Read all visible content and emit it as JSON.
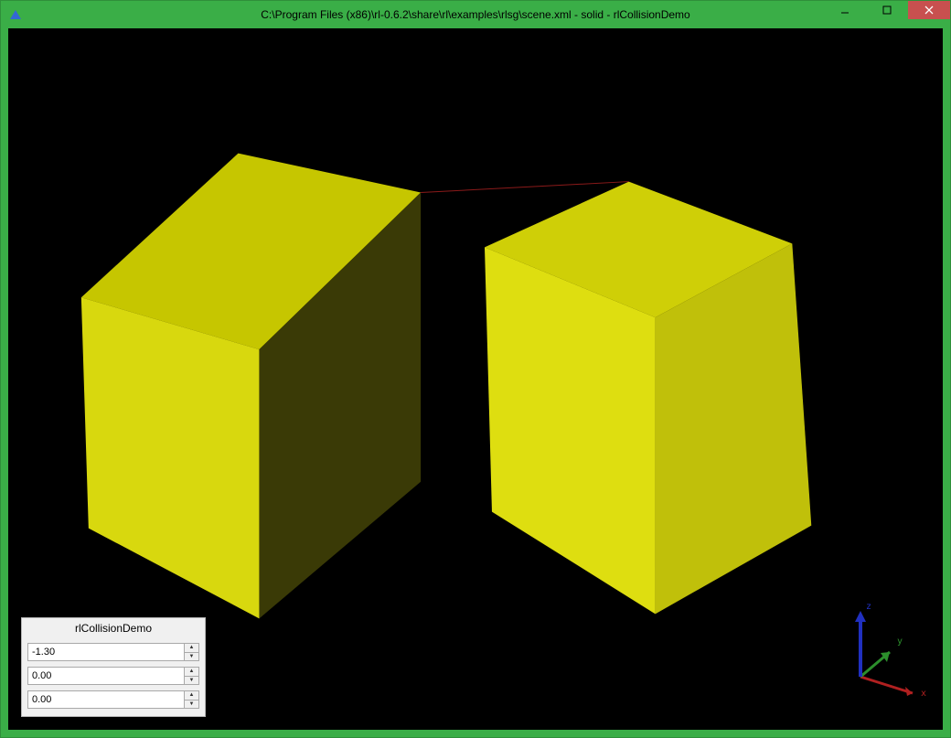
{
  "window": {
    "title": "C:\\Program Files (x86)\\rl-0.6.2\\share\\rl\\examples\\rlsg\\scene.xml - solid - rlCollisionDemo"
  },
  "panel": {
    "title": "rlCollisionDemo",
    "fields": [
      {
        "value": "-1.30"
      },
      {
        "value": "0.00"
      },
      {
        "value": "0.00"
      }
    ]
  },
  "gizmo": {
    "x_label": "x",
    "y_label": "y",
    "z_label": "z"
  },
  "colors": {
    "window_chrome": "#3aae47",
    "close_button": "#c8504f",
    "scene_background": "#000000",
    "cube": "#d8d80e",
    "axis_x": "#c02020",
    "axis_y": "#2c8f2c",
    "axis_z": "#2030c0"
  }
}
